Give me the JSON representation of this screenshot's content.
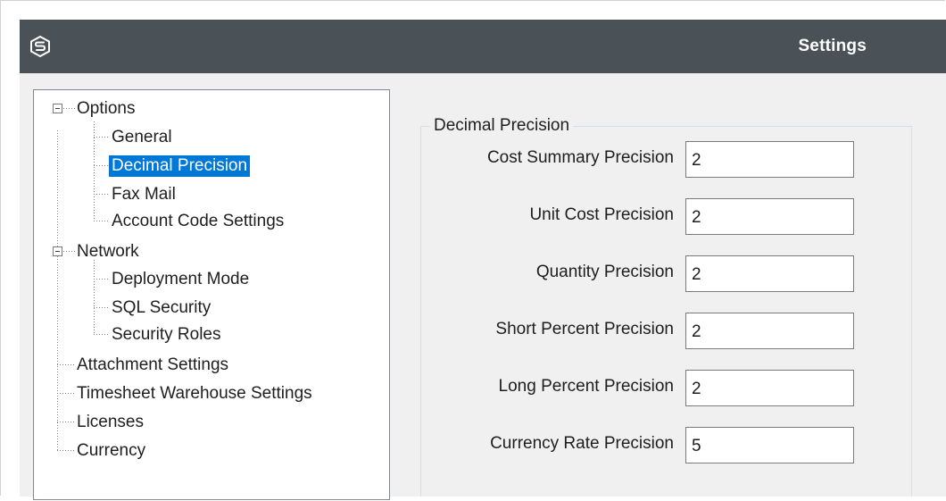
{
  "window": {
    "title": "Settings",
    "logo_icon": "app-logo-icon"
  },
  "tree": {
    "options": {
      "label": "Options",
      "children": [
        "General",
        "Decimal Precision",
        "Fax Mail",
        "Account Code Settings"
      ]
    },
    "network": {
      "label": "Network",
      "children": [
        "Deployment Mode",
        "SQL Security",
        "Security Roles"
      ]
    },
    "root_items": [
      "Attachment Settings",
      "Timesheet Warehouse Settings",
      "Licenses",
      "Currency"
    ],
    "selected": "Decimal Precision"
  },
  "decimal_precision": {
    "group_title": "Decimal Precision",
    "fields": [
      {
        "label": "Cost Summary Precision",
        "value": "2"
      },
      {
        "label": "Unit Cost Precision",
        "value": "2"
      },
      {
        "label": "Quantity Precision",
        "value": "2"
      },
      {
        "label": "Short Percent Precision",
        "value": "2"
      },
      {
        "label": "Long Percent Precision",
        "value": "2"
      },
      {
        "label": "Currency Rate Precision",
        "value": "5"
      }
    ]
  },
  "colors": {
    "titlebar": "#4a5257",
    "selection": "#0078d7",
    "dialog_bg": "#f0f0f0"
  }
}
